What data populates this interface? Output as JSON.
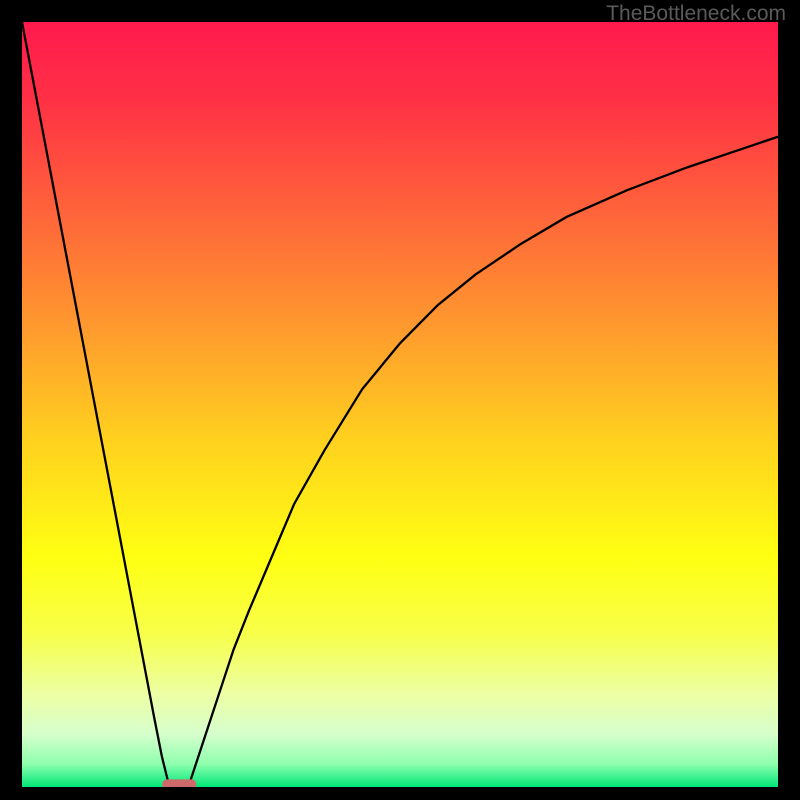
{
  "watermark": "TheBottleneck.com",
  "chart_data": {
    "type": "line",
    "title": "",
    "xlabel": "",
    "ylabel": "",
    "xlim": [
      0,
      100
    ],
    "ylim": [
      0,
      100
    ],
    "grid": false,
    "legend": false,
    "annotations": [],
    "series": [
      {
        "name": "left-branch",
        "x": [
          0,
          5,
          10,
          15,
          17.5,
          18.5,
          19.5
        ],
        "y": [
          100,
          74,
          48,
          22,
          9,
          4,
          0
        ]
      },
      {
        "name": "right-branch",
        "x": [
          22,
          24,
          26,
          28,
          30,
          33,
          36,
          40,
          45,
          50,
          55,
          60,
          66,
          72,
          80,
          88,
          94,
          100
        ],
        "y": [
          0,
          6,
          12,
          18,
          23,
          30,
          37,
          44,
          52,
          58,
          63,
          67,
          71,
          74.5,
          78,
          81,
          83,
          85
        ]
      }
    ],
    "marker": {
      "name": "optimal-point",
      "x": 20.8,
      "y": 0,
      "color": "#cf6a6a"
    },
    "background_gradient": {
      "direction": "vertical",
      "stops": [
        {
          "pos": 0.0,
          "color": "#ff1a4d"
        },
        {
          "pos": 0.1,
          "color": "#ff3045"
        },
        {
          "pos": 0.25,
          "color": "#ff643a"
        },
        {
          "pos": 0.4,
          "color": "#ff9a2e"
        },
        {
          "pos": 0.55,
          "color": "#ffd21e"
        },
        {
          "pos": 0.7,
          "color": "#ffff12"
        },
        {
          "pos": 0.8,
          "color": "#f7ff4a"
        },
        {
          "pos": 0.88,
          "color": "#ecffa5"
        },
        {
          "pos": 0.93,
          "color": "#d7ffcc"
        },
        {
          "pos": 0.97,
          "color": "#8effae"
        },
        {
          "pos": 1.0,
          "color": "#00e777"
        }
      ]
    }
  }
}
